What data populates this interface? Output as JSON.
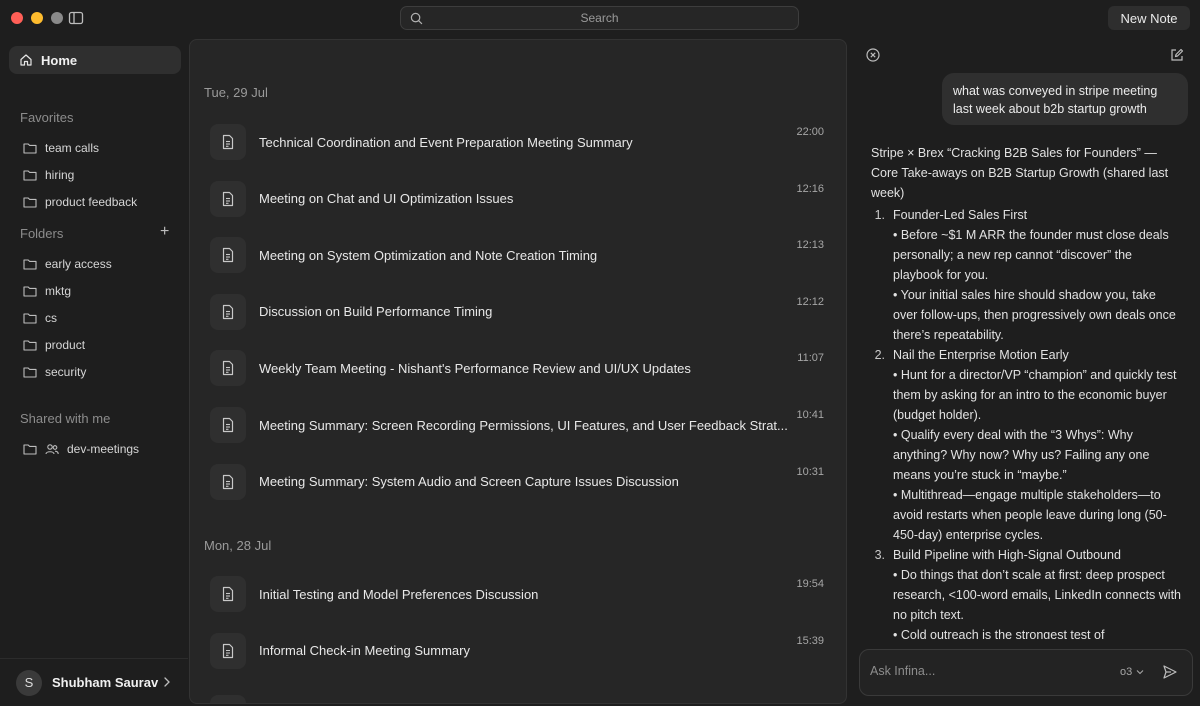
{
  "titlebar": {
    "search_placeholder": "Search",
    "new_note_label": "New Note"
  },
  "sidebar": {
    "home_label": "Home",
    "favorites_label": "Favorites",
    "favorites": [
      "team calls",
      "hiring",
      "product feedback"
    ],
    "folders_label": "Folders",
    "folders": [
      "early access",
      "mktg",
      "cs",
      "product",
      "security"
    ],
    "shared_label": "Shared with me",
    "shared": [
      "dev-meetings"
    ],
    "user_initial": "S",
    "user_name": "Shubham Saurav"
  },
  "notes": {
    "groups": [
      {
        "date": "Tue, 29 Jul",
        "items": [
          {
            "title": "Technical Coordination and Event Preparation Meeting Summary",
            "time": "22:00"
          },
          {
            "title": "Meeting on Chat and UI Optimization Issues",
            "time": "12:16"
          },
          {
            "title": "Meeting on System Optimization and Note Creation Timing",
            "time": "12:13"
          },
          {
            "title": "Discussion on Build Performance Timing",
            "time": "12:12"
          },
          {
            "title": "Weekly Team Meeting - Nishant's Performance Review and UI/UX Updates",
            "time": "11:07"
          },
          {
            "title": "Meeting Summary: Screen Recording Permissions, UI Features, and User Feedback Strat...",
            "time": "10:41"
          },
          {
            "title": "Meeting Summary: System Audio and Screen Capture Issues Discussion",
            "time": "10:31"
          }
        ]
      },
      {
        "date": "Mon, 28 Jul",
        "items": [
          {
            "title": "Initial Testing and Model Preferences Discussion",
            "time": "19:54"
          },
          {
            "title": "Informal Check-in Meeting Summary",
            "time": "15:39"
          }
        ]
      }
    ]
  },
  "chat": {
    "user_message": "what was conveyed in stripe meeting last week about b2b startup growth",
    "answer_intro": "Stripe × Brex “Cracking B2B Sales for Founders” — Core Take-aways on B2B Startup Growth (shared last week)",
    "sections": [
      {
        "num": "1.",
        "title": "Founder-Led Sales First",
        "bullets": [
          "• Before ~$1 M ARR the founder must close deals personally; a new rep cannot “discover” the playbook for you.",
          "• Your initial sales hire should shadow you, take over follow-ups, then progressively own deals once there’s repeatability."
        ]
      },
      {
        "num": "2.",
        "title": "Nail the Enterprise Motion Early",
        "bullets": [
          "• Hunt for a director/VP “champion” and quickly test them by asking for an intro to the economic buyer (budget holder).",
          "• Qualify every deal with the “3 Whys”: Why anything? Why now? Why us? Failing any one means you’re stuck in “maybe.”",
          "• Multithread—engage multiple stakeholders—to avoid restarts when people leave during long (50-450-day) enterprise cycles."
        ]
      },
      {
        "num": "3.",
        "title": "Build Pipeline with High-Signal Outbound",
        "bullets": [
          "• Do things that don’t scale at first: deep prospect research, <100-word emails, LinkedIn connects with no pitch text.",
          "• Cold outreach is the strongest test of"
        ]
      }
    ],
    "input_placeholder": "Ask Infina...",
    "model_label": "o3"
  }
}
